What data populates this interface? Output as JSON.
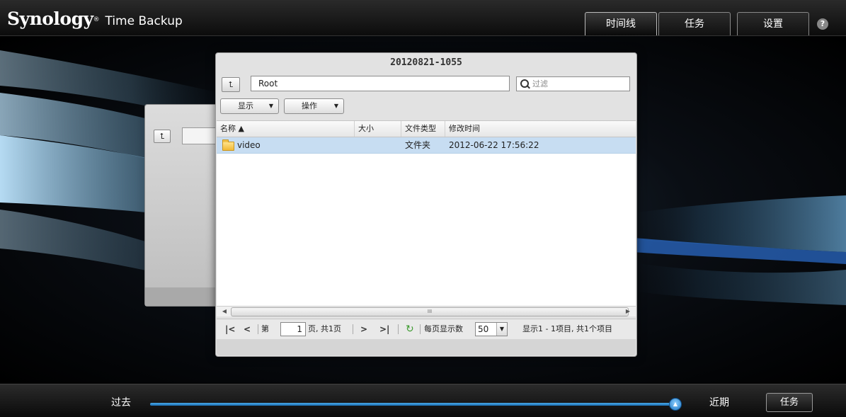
{
  "app": {
    "brand": "Synology",
    "brand_mark": "®",
    "name": "Time Backup"
  },
  "tabs": [
    {
      "label": "时间线",
      "active": true
    },
    {
      "label": "任务",
      "active": false
    },
    {
      "label": "设置",
      "active": false
    }
  ],
  "help_label": "?",
  "dialog": {
    "title": "20120821-1055",
    "path": "Root",
    "filter_placeholder": "过滤",
    "buttons": {
      "display": "显示",
      "action": "操作"
    },
    "columns": [
      "名称 ▲",
      "大小",
      "文件类型",
      "修改时间"
    ],
    "rows": [
      {
        "name": "video",
        "size": "",
        "type": "文件夹",
        "modified": "2012-06-22 17:56:22"
      }
    ],
    "scroll_grip": "III",
    "pager": {
      "page_prefix": "第",
      "page": "1",
      "page_suffix": "页, 共1页",
      "per_page_label": "每页显示数",
      "per_page": "50",
      "summary": "显示1 - 1项目, 共1个项目"
    }
  },
  "timeline": {
    "past_label": "过去",
    "recent_label": "近期",
    "position": 1.0,
    "task_button": "任务"
  },
  "colors": {
    "accent": "#1c75c2",
    "selection": "#c7ddf2"
  }
}
